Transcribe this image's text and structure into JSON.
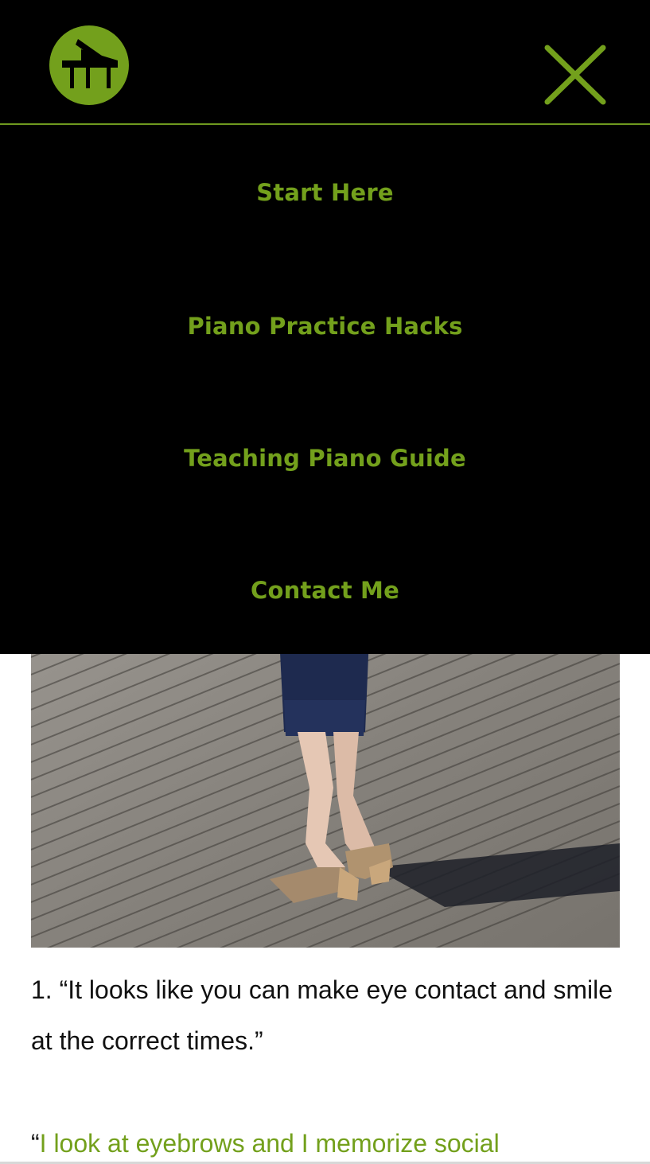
{
  "theme": {
    "accent": "#73a01c",
    "nav_background": "#000000"
  },
  "header": {
    "logo_icon": "grand-piano-icon",
    "close_icon": "close-x-icon"
  },
  "menu": {
    "items": [
      {
        "label": "Start Here"
      },
      {
        "label": "Piano Practice Hacks"
      },
      {
        "label": "Teaching Piano Guide"
      },
      {
        "label": "Contact Me"
      }
    ]
  },
  "article": {
    "point_text": "1. “It looks like you can make eye contact and smile at the correct times.”",
    "quote_open": "“",
    "quote_text": "I look at eyebrows and I memorize social"
  }
}
